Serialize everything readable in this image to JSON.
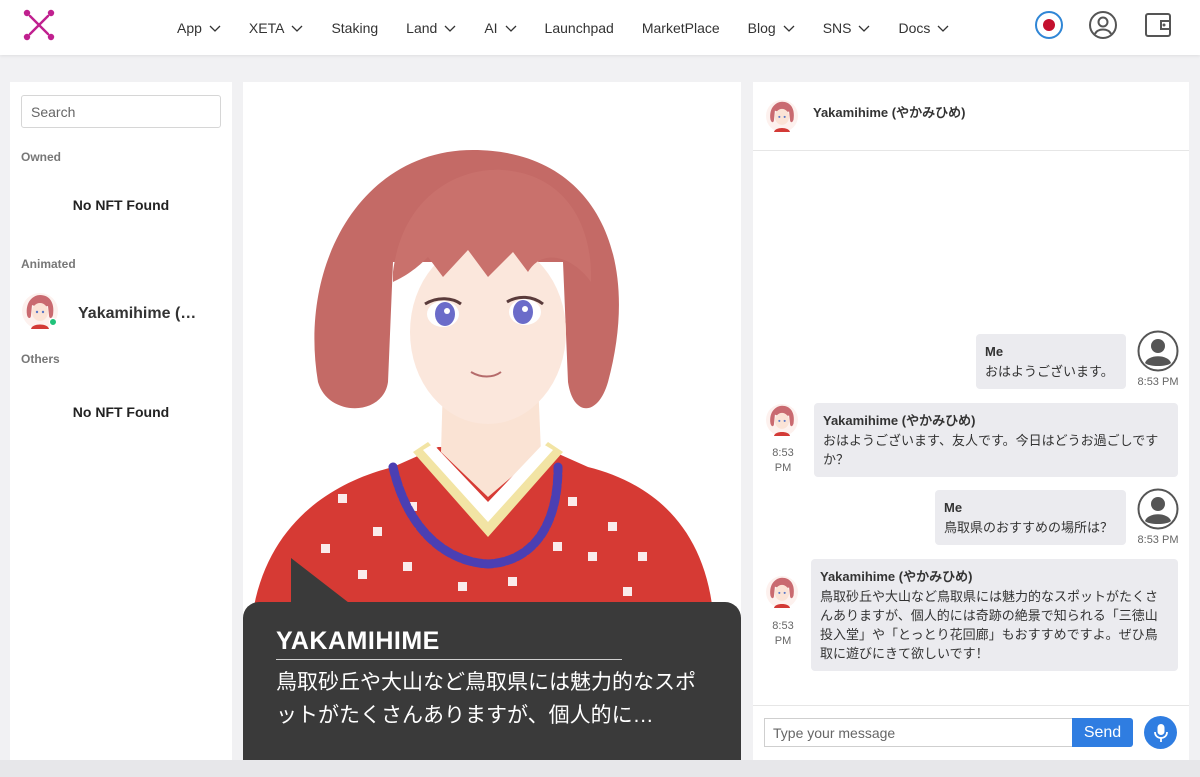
{
  "nav": {
    "items": [
      {
        "label": "App",
        "dropdown": true
      },
      {
        "label": "XETA",
        "dropdown": true
      },
      {
        "label": "Staking",
        "dropdown": false
      },
      {
        "label": "Land",
        "dropdown": true
      },
      {
        "label": "AI",
        "dropdown": true
      },
      {
        "label": "Launchpad",
        "dropdown": false
      },
      {
        "label": "MarketPlace",
        "dropdown": false
      },
      {
        "label": "Blog",
        "dropdown": true
      },
      {
        "label": "SNS",
        "dropdown": true
      },
      {
        "label": "Docs",
        "dropdown": true
      }
    ],
    "icons": [
      "record-icon",
      "user-account-icon",
      "wallet-icon"
    ],
    "brand_color": "#c0208f",
    "accent_color": "#2f7de1"
  },
  "sidebar": {
    "search_placeholder": "Search",
    "owned_label": "Owned",
    "owned_empty": "No NFT Found",
    "animated_label": "Animated",
    "animated_item": {
      "name": "Yakamihime (やかみひめ)",
      "status": "online"
    },
    "others_label": "Others",
    "others_empty": "No NFT Found"
  },
  "stage": {
    "speaker": "YAKAMIHIME",
    "caption": "鳥取砂丘や大山など鳥取県には魅力的なスポットがたくさんありますが、個人的に…"
  },
  "chat": {
    "header_name": "Yakamihime (やかみひめ)",
    "messages": [
      {
        "from": "user",
        "sender": "Me",
        "text": "おはようございます。",
        "time": "8:53 PM"
      },
      {
        "from": "bot",
        "sender": "Yakamihime (やかみひめ)",
        "text": "おはようございます、友人です。今日はどうお過ごしですか？",
        "time": "8:53 PM"
      },
      {
        "from": "user",
        "sender": "Me",
        "text": "鳥取県のおすすめの場所は？",
        "time": "8:53 PM"
      },
      {
        "from": "bot",
        "sender": "Yakamihime (やかみひめ)",
        "text": "鳥取砂丘や大山など鳥取県には魅力的なスポットがたくさんありますが、個人的には奇跡の絶景で知られる「三徳山投入堂」や「とっとり花回廊」もおすすめですよ。ぜひ鳥取に遊びにきて欲しいです！",
        "time": "8:53 PM"
      }
    ],
    "input_placeholder": "Type your message",
    "send_label": "Send"
  }
}
